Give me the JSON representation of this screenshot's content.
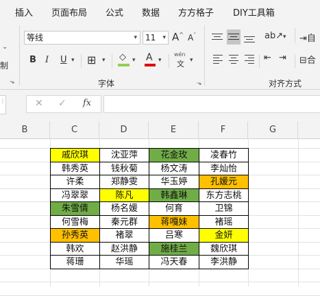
{
  "menu": [
    "插入",
    "页面布局",
    "公式",
    "数据",
    "方方格子",
    "DIY工具箱"
  ],
  "font": {
    "name": "等线",
    "size": "11",
    "grow_label": "A",
    "shrink_label": "A",
    "group_label": "字体"
  },
  "align": {
    "group_label": "对齐方式",
    "wrap_label": "自",
    "merge_label": "合"
  },
  "ribbon_left": {
    "top": "`",
    "bottom": "制"
  },
  "formula": {
    "fx": "fx"
  },
  "columns": [
    "B",
    "C",
    "D",
    "E",
    "F",
    "G"
  ],
  "colors": {
    "yellow": "#ffff00",
    "green": "#70ad47",
    "orange": "#ffc000",
    "white": "#ffffff"
  },
  "table": [
    [
      {
        "t": "戚欣琪",
        "c": "yellow"
      },
      {
        "t": "沈亚萍",
        "c": "white"
      },
      {
        "t": "花金玫",
        "c": "green"
      },
      {
        "t": "凌春竹",
        "c": "white"
      }
    ],
    [
      {
        "t": "韩秀英",
        "c": "white"
      },
      {
        "t": "钱秋菊",
        "c": "white"
      },
      {
        "t": "杨文涛",
        "c": "white"
      },
      {
        "t": "李灿怡",
        "c": "white"
      }
    ],
    [
      {
        "t": "许柔",
        "c": "white"
      },
      {
        "t": "郑静雯",
        "c": "white"
      },
      {
        "t": "华玉婷",
        "c": "white"
      },
      {
        "t": "孔媛元",
        "c": "orange"
      }
    ],
    [
      {
        "t": "冯翠翠",
        "c": "white"
      },
      {
        "t": "陈凡",
        "c": "yellow"
      },
      {
        "t": "韩鑫琳",
        "c": "green"
      },
      {
        "t": "东方志桃",
        "c": "white"
      }
    ],
    [
      {
        "t": "朱雪倩",
        "c": "green"
      },
      {
        "t": "杨名媛",
        "c": "white"
      },
      {
        "t": "何育",
        "c": "white"
      },
      {
        "t": "卫锦",
        "c": "white"
      }
    ],
    [
      {
        "t": "何雪梅",
        "c": "white"
      },
      {
        "t": "秦元群",
        "c": "white"
      },
      {
        "t": "蒋嘎妹",
        "c": "orange"
      },
      {
        "t": "褚瑶",
        "c": "white"
      }
    ],
    [
      {
        "t": "孙秀英",
        "c": "orange"
      },
      {
        "t": "褚翠",
        "c": "white"
      },
      {
        "t": "吕寒",
        "c": "white"
      },
      {
        "t": "金妍",
        "c": "yellow"
      }
    ],
    [
      {
        "t": "韩欢",
        "c": "white"
      },
      {
        "t": "赵洪静",
        "c": "white"
      },
      {
        "t": "施桂兰",
        "c": "green"
      },
      {
        "t": "魏欣琪",
        "c": "white"
      }
    ],
    [
      {
        "t": "蒋珊",
        "c": "white"
      },
      {
        "t": "华瑶",
        "c": "white"
      },
      {
        "t": "冯天春",
        "c": "white"
      },
      {
        "t": "李洪静",
        "c": "white"
      }
    ]
  ]
}
